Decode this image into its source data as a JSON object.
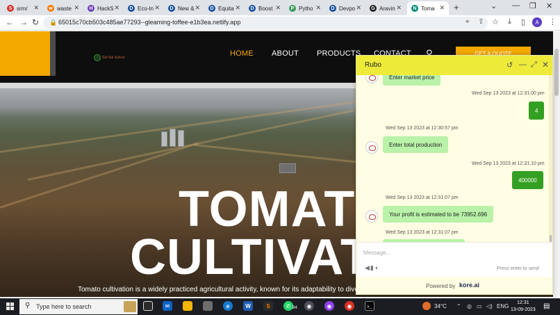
{
  "browser": {
    "tabs": [
      {
        "label": "srm/",
        "icon_color": "#d93025",
        "glyph": "S"
      },
      {
        "label": "waste",
        "icon_color": "#f57c00",
        "glyph": "w"
      },
      {
        "label": "HackS",
        "icon_color": "#6a3fb5",
        "glyph": "H"
      },
      {
        "label": "Eco-In",
        "icon_color": "#1a4f9c",
        "glyph": "D"
      },
      {
        "label": "New &",
        "icon_color": "#1a4f9c",
        "glyph": "D"
      },
      {
        "label": "Equita",
        "icon_color": "#1a4f9c",
        "glyph": "D"
      },
      {
        "label": "Boost",
        "icon_color": "#1a4f9c",
        "glyph": "D"
      },
      {
        "label": "Pytho",
        "icon_color": "#3c9a5f",
        "glyph": "P"
      },
      {
        "label": "Devpo",
        "icon_color": "#1a4f9c",
        "glyph": "D"
      },
      {
        "label": "Aravin",
        "icon_color": "#222222",
        "glyph": "G"
      },
      {
        "label": "Toma",
        "icon_color": "#00897b",
        "glyph": "N",
        "active": true
      }
    ],
    "url": "65015c70cb503c485ae77293--gleaming-toffee-e1b3ea.netlify.app",
    "profile_initial": "A"
  },
  "site": {
    "brand_name": "Sai Sai Sukva",
    "nav": {
      "home": "HOME",
      "about": "ABOUT",
      "products": "PRODUCTS",
      "contact": "CONTACT"
    },
    "cta": "GET A QUOTE",
    "hero": {
      "title_line1": "TOMATO",
      "title_line2": "CULTIVATION",
      "subtitle": "Tomato cultivation is a widely practiced agricultural activity, known for its adaptability to diverse"
    }
  },
  "chat": {
    "title": "Rubo",
    "messages": {
      "m0": {
        "from": "bot",
        "text": "Enter market price"
      },
      "m1": {
        "from": "user",
        "time": "Wed Sep 13 2023 at 12:31:00 pm",
        "text": "4"
      },
      "m2": {
        "from": "bot",
        "time": "Wed Sep 13 2023 at 12:30:57 pm",
        "text": "Enter total production"
      },
      "m3": {
        "from": "user",
        "time": "Wed Sep 13 2023 at 12:31:10 pm",
        "text": "400000"
      },
      "m4": {
        "from": "bot",
        "time": "Wed Sep 13 2023 at 12:31:07 pm",
        "text": "Your profit is estimated to be 73952.696"
      },
      "m5": {
        "from": "bot",
        "time": "Wed Sep 13 2023 at 12:31:07 pm",
        "text": ""
      }
    },
    "input_placeholder": "Message...",
    "press_enter": "Press enter to send",
    "powered_by": "Powered by",
    "powered_brand": "kore.ai"
  },
  "taskbar": {
    "search_placeholder": "Type here to search",
    "whatsapp_badge": "84",
    "weather": "34°C",
    "language": "ENG",
    "time": "12:31",
    "date": "13-09-2023"
  }
}
